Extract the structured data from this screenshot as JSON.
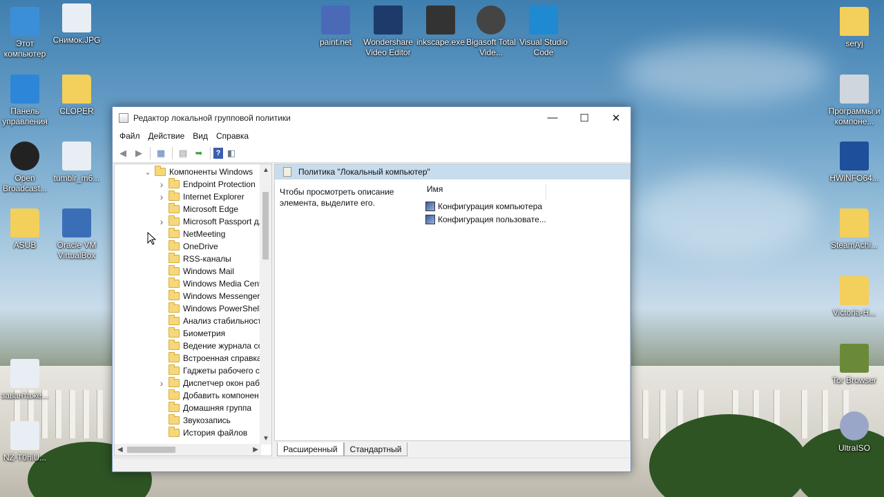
{
  "desktop": {
    "icons_left": [
      {
        "label": "Этот компьютер",
        "icon": "this-pc-icon"
      },
      {
        "label": "Снимок.JPG",
        "icon": "image-file-icon"
      },
      {
        "label": "Панель управления",
        "icon": "control-panel-icon"
      },
      {
        "label": "CLOPER",
        "icon": "folder-icon"
      },
      {
        "label": "Open Broadcast...",
        "icon": "obs-icon"
      },
      {
        "label": "tumblr_m6...",
        "icon": "image-file-icon"
      },
      {
        "label": "ASUB",
        "icon": "folder-icon"
      },
      {
        "label": "Oracle VM VirtualBox",
        "icon": "virtualbox-icon"
      },
      {
        "label": "завантаже...",
        "icon": "image-file-icon"
      },
      {
        "label": "NZ-T0hiU...",
        "icon": "image-file-icon"
      }
    ],
    "icons_top": [
      {
        "label": "paint.net",
        "icon": "paintnet-icon"
      },
      {
        "label": "Wondershare Video Editor",
        "icon": "wondershare-icon"
      },
      {
        "label": "inkscape.exe",
        "icon": "inkscape-icon"
      },
      {
        "label": "Bigasoft Total Vide...",
        "icon": "bigasoft-icon"
      },
      {
        "label": "Visual Studio Code",
        "icon": "vscode-icon"
      }
    ],
    "icons_right": [
      {
        "label": "seryj",
        "icon": "folder-icon"
      },
      {
        "label": "Программы и компоне...",
        "icon": "programs-icon"
      },
      {
        "label": "HWiNFO64...",
        "icon": "hwinfo-icon"
      },
      {
        "label": "SteamAchi...",
        "icon": "folder-icon"
      },
      {
        "label": "Victoria-H...",
        "icon": "folder-icon"
      },
      {
        "label": "Tor Browser",
        "icon": "tor-icon"
      },
      {
        "label": "UltraISO",
        "icon": "ultraiso-icon"
      }
    ]
  },
  "window": {
    "title": "Редактор локальной групповой политики",
    "controls": {
      "minimize": "—",
      "maximize": "☐",
      "close": "✕"
    },
    "menu": [
      "Файл",
      "Действие",
      "Вид",
      "Справка"
    ],
    "tree": {
      "root": "Компоненты Windows",
      "items": [
        {
          "label": "Endpoint Protection",
          "expandable": true
        },
        {
          "label": "Internet Explorer",
          "expandable": true
        },
        {
          "label": "Microsoft Edge",
          "expandable": false
        },
        {
          "label": "Microsoft Passport для",
          "expandable": true
        },
        {
          "label": "NetMeeting",
          "expandable": false
        },
        {
          "label": "OneDrive",
          "expandable": false
        },
        {
          "label": "RSS-каналы",
          "expandable": false
        },
        {
          "label": "Windows Mail",
          "expandable": false
        },
        {
          "label": "Windows Media Center",
          "expandable": false
        },
        {
          "label": "Windows Messenger",
          "expandable": false
        },
        {
          "label": "Windows PowerShell",
          "expandable": false
        },
        {
          "label": "Анализ стабильности",
          "expandable": false
        },
        {
          "label": "Биометрия",
          "expandable": false
        },
        {
          "label": "Ведение журнала со",
          "expandable": false
        },
        {
          "label": "Встроенная справка",
          "expandable": false
        },
        {
          "label": "Гаджеты рабочего с",
          "expandable": false
        },
        {
          "label": "Диспетчер окон раб",
          "expandable": true
        },
        {
          "label": "Добавить компонен",
          "expandable": false
        },
        {
          "label": "Домашняя группа",
          "expandable": false
        },
        {
          "label": "Звукозапись",
          "expandable": false
        },
        {
          "label": "История файлов",
          "expandable": false
        }
      ]
    },
    "details": {
      "header": "Политика \"Локальный компьютер\"",
      "description": "Чтобы просмотреть описание элемента, выделите его.",
      "column_name": "Имя",
      "rows": [
        "Конфигурация компьютера",
        "Конфигурация пользовате..."
      ]
    },
    "tabs": [
      "Расширенный",
      "Стандартный"
    ]
  }
}
